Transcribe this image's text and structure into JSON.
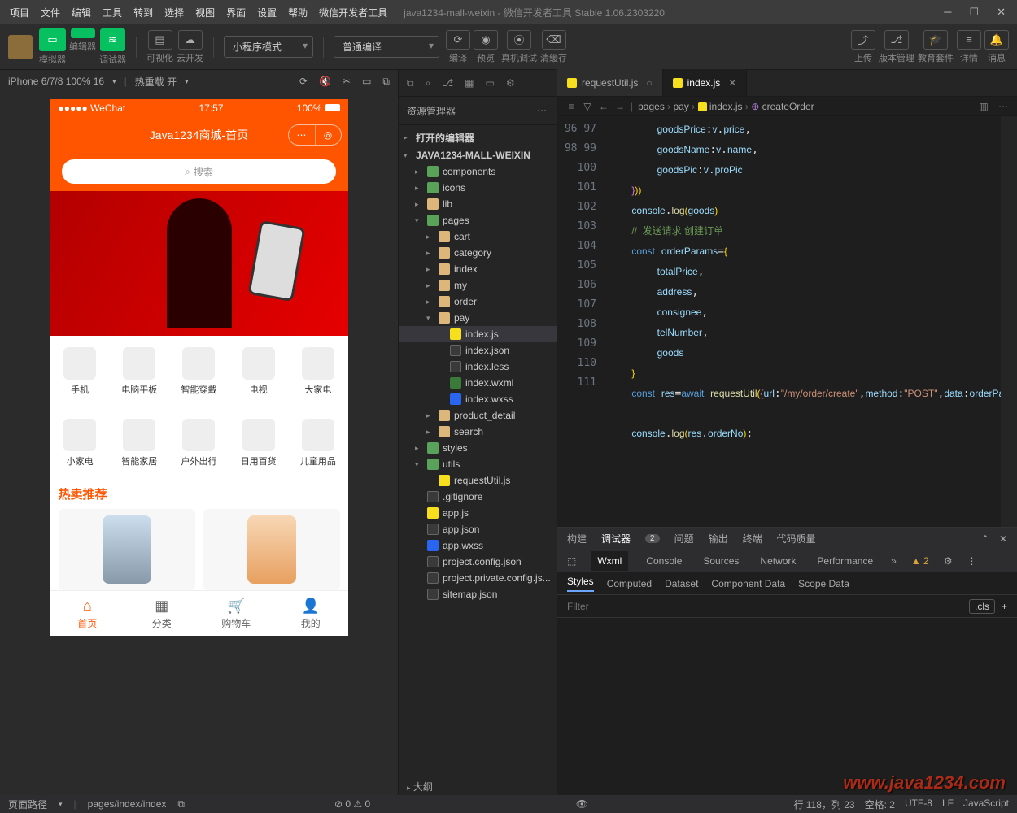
{
  "window": {
    "menu": [
      "项目",
      "文件",
      "编辑",
      "工具",
      "转到",
      "选择",
      "视图",
      "界面",
      "设置",
      "帮助",
      "微信开发者工具"
    ],
    "title": "java1234-mall-weixin - 微信开发者工具 Stable 1.06.2303220"
  },
  "toolbar": {
    "groups": [
      {
        "icon": "▭",
        "label": "模拟器"
      },
      {
        "icon": "</>",
        "label": "编辑器"
      },
      {
        "icon": "≋",
        "label": "调试器"
      }
    ],
    "extra": [
      {
        "icon": "▤",
        "label": "可视化"
      },
      {
        "icon": "☁",
        "label": "云开发"
      }
    ],
    "modeDropdown": "小程序模式",
    "compileDropdown": "普通编译",
    "actions": [
      {
        "icon": "⟳",
        "label": "编译"
      },
      {
        "icon": "◉",
        "label": "预览"
      },
      {
        "icon": "⦿",
        "label": "真机调试"
      },
      {
        "icon": "⌫",
        "label": "清缓存"
      }
    ],
    "right": [
      {
        "icon": "⤴",
        "label": "上传"
      },
      {
        "icon": "⎇",
        "label": "版本管理"
      },
      {
        "icon": "🎓",
        "label": "教育套件"
      },
      {
        "icon": "≡",
        "label": "详情"
      },
      {
        "icon": "🔔",
        "label": "消息"
      }
    ]
  },
  "simBar": {
    "device": "iPhone 6/7/8 100% 16",
    "reload": "热重载 开"
  },
  "phone": {
    "status": {
      "left": "●●●●● WeChat",
      "center": "17:57",
      "right": "100%"
    },
    "headerTitle": "Java1234商城-首页",
    "searchPlaceholder": "搜索",
    "gridRow1": [
      "手机",
      "电脑平板",
      "智能穿戴",
      "电视",
      "大家电"
    ],
    "gridRow2": [
      "小家电",
      "智能家居",
      "户外出行",
      "日用百货",
      "儿童用品"
    ],
    "section": "热卖推荐",
    "tabs": [
      {
        "label": "首页",
        "active": true
      },
      {
        "label": "分类",
        "active": false
      },
      {
        "label": "购物车",
        "active": false
      },
      {
        "label": "我的",
        "active": false
      }
    ]
  },
  "explorer": {
    "title": "资源管理器",
    "openEditors": "打开的编辑器",
    "project": "JAVA1234-MALL-WEIXIN",
    "tree": [
      {
        "d": 1,
        "t": "f",
        "c": "▸",
        "n": "components",
        "cls": "folder-g"
      },
      {
        "d": 1,
        "t": "f",
        "c": "▸",
        "n": "icons",
        "cls": "folder-g"
      },
      {
        "d": 1,
        "t": "f",
        "c": "▸",
        "n": "lib",
        "cls": "folder"
      },
      {
        "d": 1,
        "t": "f",
        "c": "▾",
        "n": "pages",
        "cls": "folder-g"
      },
      {
        "d": 2,
        "t": "f",
        "c": "▸",
        "n": "cart",
        "cls": "folder"
      },
      {
        "d": 2,
        "t": "f",
        "c": "▸",
        "n": "category",
        "cls": "folder"
      },
      {
        "d": 2,
        "t": "f",
        "c": "▸",
        "n": "index",
        "cls": "folder"
      },
      {
        "d": 2,
        "t": "f",
        "c": "▸",
        "n": "my",
        "cls": "folder"
      },
      {
        "d": 2,
        "t": "f",
        "c": "▸",
        "n": "order",
        "cls": "folder"
      },
      {
        "d": 2,
        "t": "f",
        "c": "▾",
        "n": "pay",
        "cls": "folder"
      },
      {
        "d": 3,
        "t": "file",
        "n": "index.js",
        "cls": "js",
        "sel": true
      },
      {
        "d": 3,
        "t": "file",
        "n": "index.json",
        "cls": "jsonb"
      },
      {
        "d": 3,
        "t": "file",
        "n": "index.less",
        "cls": "jsonb"
      },
      {
        "d": 3,
        "t": "file",
        "n": "index.wxml",
        "cls": "wxml"
      },
      {
        "d": 3,
        "t": "file",
        "n": "index.wxss",
        "cls": "wxss"
      },
      {
        "d": 2,
        "t": "f",
        "c": "▸",
        "n": "product_detail",
        "cls": "folder"
      },
      {
        "d": 2,
        "t": "f",
        "c": "▸",
        "n": "search",
        "cls": "folder"
      },
      {
        "d": 1,
        "t": "f",
        "c": "▸",
        "n": "styles",
        "cls": "folder-g"
      },
      {
        "d": 1,
        "t": "f",
        "c": "▾",
        "n": "utils",
        "cls": "folder-g"
      },
      {
        "d": 2,
        "t": "file",
        "n": "requestUtil.js",
        "cls": "js"
      },
      {
        "d": 1,
        "t": "file",
        "n": ".gitignore",
        "cls": "jsonb"
      },
      {
        "d": 1,
        "t": "file",
        "n": "app.js",
        "cls": "js"
      },
      {
        "d": 1,
        "t": "file",
        "n": "app.json",
        "cls": "jsonb"
      },
      {
        "d": 1,
        "t": "file",
        "n": "app.wxss",
        "cls": "wxss"
      },
      {
        "d": 1,
        "t": "file",
        "n": "project.config.json",
        "cls": "jsonb"
      },
      {
        "d": 1,
        "t": "file",
        "n": "project.private.config.js...",
        "cls": "jsonb"
      },
      {
        "d": 1,
        "t": "file",
        "n": "sitemap.json",
        "cls": "jsonb"
      }
    ],
    "outline": "大纲"
  },
  "editor": {
    "tabs": [
      {
        "name": "requestUtil.js",
        "active": false
      },
      {
        "name": "index.js",
        "active": true
      }
    ],
    "breadcrumb": [
      "pages",
      "pay",
      "index.js",
      "createOrder"
    ],
    "startLine": 96,
    "lines": [
      "        <span class='prop'>goodsPrice</span>:<span class='prop'>v</span>.<span class='prop'>price</span>,",
      "        <span class='prop'>goodsName</span>:<span class='prop'>v</span>.<span class='prop'>name</span>,",
      "        <span class='prop'>goodsPic</span>:<span class='prop'>v</span>.<span class='prop'>proPic</span>",
      "    <span class='pn2'>}</span><span class='pn'>)</span><span class='pn'>)</span>",
      "    <span class='prop'>console</span>.<span class='fn'>log</span><span class='pn'>(</span><span class='prop'>goods</span><span class='pn'>)</span>",
      "    <span class='cm'>//  发送请求 创建订单</span>",
      "    <span class='kw'>const</span> <span class='prop'>orderParams</span>=<span class='pn'>{</span>",
      "        <span class='prop'>totalPrice</span>,",
      "        <span class='prop'>address</span>,",
      "        <span class='prop'>consignee</span>,",
      "        <span class='prop'>telNumber</span>,",
      "        <span class='prop'>goods</span>",
      "    <span class='pn'>}</span>",
      "    <span class='kw'>const</span> <span class='prop'>res</span>=<span class='kw'>await</span> <span class='fn'>requestUtil</span><span class='pn'>(</span><span class='pn2'>{</span><span class='prop'>url</span>:<span class='str'>\"/my/order/create\"</span>,<span class='prop'>method</span>:<span class='str'>\"POST\"</span>,<span class='prop'>data</span>:<span class='prop'>orderParams</span><span class='pn2'>}</span><span class='pn'>)</span>;",
      "",
      "    <span class='prop'>console</span>.<span class='fn'>log</span><span class='pn'>(</span><span class='prop'>res</span>.<span class='prop'>orderNo</span><span class='pn'>)</span>;"
    ]
  },
  "devtools": {
    "top": [
      "构建",
      "调试器",
      "问题",
      "输出",
      "终端",
      "代码质量"
    ],
    "topActive": "调试器",
    "topBadge": "2",
    "tabs": [
      "Wxml",
      "Console",
      "Sources",
      "Network",
      "Performance"
    ],
    "tabsActive": "Wxml",
    "warn": "2",
    "sub": [
      "Styles",
      "Computed",
      "Dataset",
      "Component Data",
      "Scope Data"
    ],
    "subActive": "Styles",
    "filterPlaceholder": "Filter",
    "cls": ".cls"
  },
  "status": {
    "left": [
      "页面路径",
      "pages/index/index"
    ],
    "mid": [
      "⊘ 0 ⚠ 0"
    ],
    "right": [
      "行 118，列 23",
      "空格: 2",
      "UTF-8",
      "LF",
      "JavaScript"
    ]
  },
  "watermark": "www.java1234.com"
}
